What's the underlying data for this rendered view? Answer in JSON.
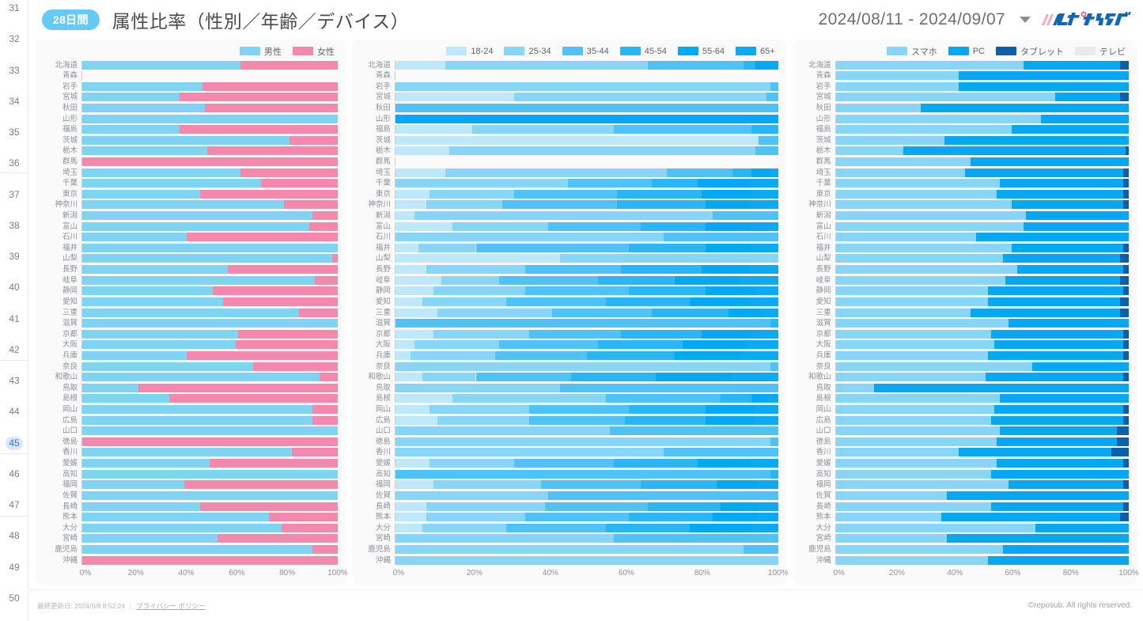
{
  "gutter": {
    "rows": [
      "31",
      "32",
      "33",
      "34",
      "35",
      "36",
      "37",
      "38",
      "39",
      "40",
      "41",
      "42",
      "43",
      "44",
      "45",
      "46",
      "47",
      "48",
      "49",
      "50"
    ],
    "active_row": "45"
  },
  "header": {
    "badge": "28日間",
    "title": "属性比率（性別／年齢／デバイス）",
    "date_range": "2024/08/11 - 2024/09/07",
    "caret_icon": "chevron-down-icon",
    "logo_text": "レポサブ"
  },
  "footer": {
    "last_updated": "最終更新日: 2024/9/8 8:52:24",
    "separator": "|",
    "privacy_link": "プライバシー ポリシー",
    "copyright": "©reposub. All rights reserved."
  },
  "colors": {
    "male": "#7fd4f4",
    "female": "#f589ad",
    "age_18_24": "#bfe9fb",
    "age_25_34": "#87d6f7",
    "age_35_44": "#4fc3f7",
    "age_45_54": "#29b6f6",
    "age_55_64": "#03a9f4",
    "age_65p": "#0ca9f5",
    "dev_smartphone": "#87d6f7",
    "dev_pc": "#06a7f3",
    "dev_tablet": "#0d5fa8",
    "dev_tv": "#eaeaea",
    "badge_bg": "#66cbf2",
    "active_row_bg": "#d9e7fd"
  },
  "prefectures": [
    "北海道",
    "青森",
    "岩手",
    "宮城",
    "秋田",
    "山形",
    "福島",
    "茨城",
    "栃木",
    "群馬",
    "埼玉",
    "千葉",
    "東京",
    "神奈川",
    "新潟",
    "富山",
    "石川",
    "福井",
    "山梨",
    "長野",
    "岐阜",
    "静岡",
    "愛知",
    "三重",
    "滋賀",
    "京都",
    "大阪",
    "兵庫",
    "奈良",
    "和歌山",
    "鳥取",
    "島根",
    "岡山",
    "広島",
    "山口",
    "徳島",
    "香川",
    "愛媛",
    "高知",
    "福岡",
    "佐賀",
    "長崎",
    "熊本",
    "大分",
    "宮崎",
    "鹿児島",
    "沖縄"
  ],
  "axis_ticks": [
    "0%",
    "20%",
    "40%",
    "60%",
    "80%",
    "100%"
  ],
  "chart_data": [
    {
      "id": "gender",
      "type": "bar",
      "orientation": "horizontal",
      "stacked": true,
      "normalized": true,
      "title": "",
      "xlabel": "",
      "ylabel": "",
      "xlim": [
        0,
        100
      ],
      "grid": false,
      "legend_position": "top-right",
      "categories": [
        "北海道",
        "青森",
        "岩手",
        "宮城",
        "秋田",
        "山形",
        "福島",
        "茨城",
        "栃木",
        "群馬",
        "埼玉",
        "千葉",
        "東京",
        "神奈川",
        "新潟",
        "富山",
        "石川",
        "福井",
        "山梨",
        "長野",
        "岐阜",
        "静岡",
        "愛知",
        "三重",
        "滋賀",
        "京都",
        "大阪",
        "兵庫",
        "奈良",
        "和歌山",
        "鳥取",
        "島根",
        "岡山",
        "広島",
        "山口",
        "徳島",
        "香川",
        "愛媛",
        "高知",
        "福岡",
        "佐賀",
        "長崎",
        "熊本",
        "大分",
        "宮崎",
        "鹿児島",
        "沖縄"
      ],
      "series": [
        {
          "name": "男性",
          "color": "#7fd4f4",
          "values": [
            62,
            0,
            47,
            38,
            48,
            100,
            38,
            81,
            49,
            0,
            62,
            70,
            46,
            79,
            90,
            89,
            41,
            100,
            98,
            57,
            91,
            51,
            55,
            85,
            100,
            61,
            60,
            41,
            67,
            93,
            22,
            34,
            90,
            90,
            100,
            0,
            82,
            50,
            100,
            40,
            100,
            46,
            73,
            78,
            53,
            90,
            0
          ]
        },
        {
          "name": "女性",
          "color": "#f589ad",
          "values": [
            38,
            0,
            53,
            62,
            52,
            0,
            62,
            19,
            51,
            100,
            38,
            30,
            54,
            21,
            10,
            11,
            59,
            0,
            2,
            43,
            9,
            49,
            45,
            15,
            0,
            39,
            40,
            59,
            33,
            7,
            78,
            66,
            10,
            10,
            0,
            100,
            18,
            50,
            0,
            60,
            0,
            54,
            27,
            22,
            47,
            10,
            100
          ]
        }
      ]
    },
    {
      "id": "age",
      "type": "bar",
      "orientation": "horizontal",
      "stacked": true,
      "normalized": true,
      "title": "",
      "xlabel": "",
      "ylabel": "",
      "xlim": [
        0,
        100
      ],
      "grid": false,
      "legend_position": "top-right",
      "categories": [
        "北海道",
        "青森",
        "岩手",
        "宮城",
        "秋田",
        "山形",
        "福島",
        "茨城",
        "栃木",
        "群馬",
        "埼玉",
        "千葉",
        "東京",
        "神奈川",
        "新潟",
        "富山",
        "石川",
        "福井",
        "山梨",
        "長野",
        "岐阜",
        "静岡",
        "愛知",
        "三重",
        "滋賀",
        "京都",
        "大阪",
        "兵庫",
        "奈良",
        "和歌山",
        "鳥取",
        "島根",
        "岡山",
        "広島",
        "山口",
        "徳島",
        "香川",
        "愛媛",
        "高知",
        "福岡",
        "佐賀",
        "長崎",
        "熊本",
        "大分",
        "宮崎",
        "鹿児島",
        "沖縄"
      ],
      "series": [
        {
          "name": "18-24",
          "color": "#bfe9fb",
          "values": [
            13,
            0,
            0,
            31,
            0,
            0,
            20,
            95,
            14,
            0,
            13,
            0,
            9,
            8,
            5,
            15,
            0,
            6,
            43,
            8,
            12,
            10,
            7,
            11,
            0,
            10,
            5,
            4,
            0,
            7,
            0,
            15,
            9,
            11,
            0,
            0,
            0,
            9,
            0,
            10,
            0,
            8,
            8,
            7,
            0,
            0,
            0
          ]
        },
        {
          "name": "25-34",
          "color": "#87d6f7",
          "values": [
            53,
            0,
            98,
            66,
            0,
            0,
            37,
            0,
            80,
            0,
            58,
            45,
            22,
            20,
            78,
            25,
            70,
            15,
            57,
            26,
            15,
            24,
            22,
            30,
            0,
            25,
            22,
            22,
            98,
            14,
            43,
            40,
            26,
            24,
            56,
            98,
            70,
            22,
            0,
            28,
            40,
            31,
            26,
            22,
            57,
            91,
            100
          ]
        },
        {
          "name": "35-44",
          "color": "#4fc3f7",
          "values": [
            25,
            0,
            2,
            3,
            100,
            0,
            36,
            5,
            6,
            0,
            17,
            22,
            27,
            30,
            17,
            24,
            30,
            40,
            0,
            25,
            26,
            27,
            26,
            26,
            98,
            24,
            26,
            24,
            2,
            25,
            57,
            30,
            26,
            25,
            44,
            2,
            30,
            26,
            98,
            26,
            60,
            27,
            27,
            26,
            43,
            9,
            0
          ]
        },
        {
          "name": "45-54",
          "color": "#29b6f6",
          "values": [
            3,
            0,
            0,
            0,
            0,
            0,
            7,
            0,
            0,
            0,
            5,
            12,
            22,
            23,
            0,
            17,
            0,
            20,
            0,
            21,
            20,
            20,
            22,
            20,
            2,
            21,
            22,
            23,
            0,
            22,
            0,
            8,
            20,
            21,
            0,
            0,
            0,
            22,
            2,
            20,
            0,
            19,
            22,
            22,
            0,
            0,
            0
          ]
        },
        {
          "name": "55-64",
          "color": "#03a9f4",
          "values": [
            4,
            0,
            0,
            0,
            0,
            100,
            0,
            0,
            0,
            0,
            5,
            14,
            13,
            12,
            0,
            12,
            0,
            12,
            0,
            13,
            17,
            13,
            15,
            9,
            0,
            13,
            17,
            18,
            0,
            20,
            0,
            4,
            13,
            13,
            0,
            0,
            0,
            14,
            0,
            11,
            0,
            10,
            12,
            16,
            0,
            0,
            0
          ]
        },
        {
          "name": "65+",
          "color": "#0ca9f5",
          "values": [
            2,
            0,
            0,
            0,
            0,
            0,
            0,
            0,
            0,
            0,
            2,
            7,
            7,
            7,
            0,
            7,
            0,
            7,
            0,
            7,
            10,
            6,
            8,
            4,
            0,
            7,
            8,
            9,
            0,
            12,
            0,
            3,
            6,
            6,
            0,
            0,
            0,
            7,
            0,
            5,
            0,
            5,
            5,
            7,
            0,
            0,
            0
          ]
        }
      ]
    },
    {
      "id": "device",
      "type": "bar",
      "orientation": "horizontal",
      "stacked": true,
      "normalized": true,
      "title": "",
      "xlabel": "",
      "ylabel": "",
      "xlim": [
        0,
        100
      ],
      "grid": false,
      "legend_position": "top-right",
      "categories": [
        "北海道",
        "青森",
        "岩手",
        "宮城",
        "秋田",
        "山形",
        "福島",
        "茨城",
        "栃木",
        "群馬",
        "埼玉",
        "千葉",
        "東京",
        "神奈川",
        "新潟",
        "富山",
        "石川",
        "福井",
        "山梨",
        "長野",
        "岐阜",
        "静岡",
        "愛知",
        "三重",
        "滋賀",
        "京都",
        "大阪",
        "兵庫",
        "奈良",
        "和歌山",
        "鳥取",
        "島根",
        "岡山",
        "広島",
        "山口",
        "徳島",
        "香川",
        "愛媛",
        "高知",
        "福岡",
        "佐賀",
        "長崎",
        "熊本",
        "大分",
        "宮崎",
        "鹿児島",
        "沖縄"
      ],
      "series": [
        {
          "name": "スマホ",
          "color": "#87d6f7",
          "values": [
            64,
            42,
            42,
            75,
            29,
            70,
            60,
            37,
            23,
            46,
            44,
            56,
            55,
            60,
            65,
            64,
            48,
            60,
            57,
            62,
            58,
            52,
            52,
            46,
            59,
            53,
            54,
            52,
            67,
            51,
            13,
            56,
            54,
            53,
            56,
            55,
            42,
            55,
            53,
            59,
            38,
            53,
            36,
            68,
            38,
            57,
            52
          ]
        },
        {
          "name": "PC",
          "color": "#06a7f3",
          "values": [
            33,
            58,
            58,
            22,
            71,
            30,
            40,
            63,
            76,
            54,
            54,
            42,
            43,
            38,
            35,
            36,
            52,
            38,
            40,
            36,
            39,
            46,
            45,
            51,
            41,
            45,
            44,
            46,
            33,
            47,
            87,
            44,
            44,
            45,
            40,
            41,
            52,
            43,
            47,
            39,
            62,
            45,
            61,
            32,
            62,
            43,
            48
          ]
        },
        {
          "name": "タブレット",
          "color": "#0d5fa8",
          "values": [
            3,
            0,
            0,
            3,
            0,
            0,
            0,
            0,
            1,
            0,
            2,
            2,
            2,
            2,
            0,
            0,
            0,
            2,
            3,
            2,
            3,
            2,
            3,
            3,
            0,
            2,
            2,
            2,
            0,
            2,
            0,
            0,
            2,
            2,
            4,
            4,
            6,
            2,
            0,
            2,
            0,
            2,
            3,
            0,
            0,
            0,
            0
          ]
        },
        {
          "name": "テレビ",
          "color": "#eaeaea",
          "values": [
            0,
            0,
            0,
            0,
            0,
            0,
            0,
            0,
            0,
            0,
            0,
            0,
            0,
            0,
            0,
            0,
            0,
            0,
            0,
            0,
            0,
            0,
            0,
            0,
            0,
            0,
            0,
            0,
            0,
            0,
            0,
            0,
            0,
            0,
            0,
            0,
            0,
            0,
            0,
            0,
            0,
            0,
            0,
            0,
            0,
            0,
            0
          ]
        }
      ]
    }
  ]
}
